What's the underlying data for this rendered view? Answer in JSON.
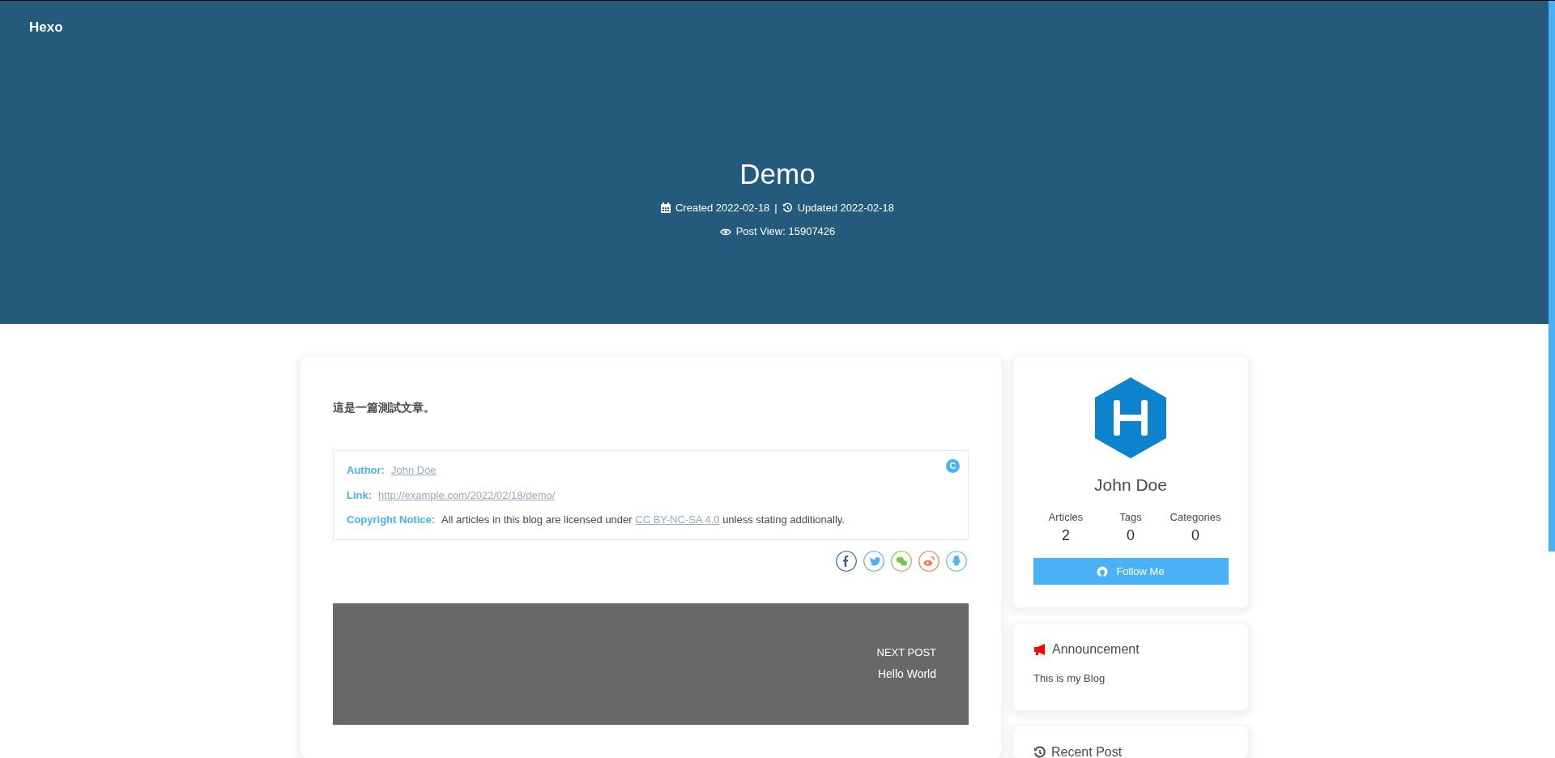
{
  "site": {
    "title": "Hexo"
  },
  "post": {
    "title": "Demo",
    "meta": [
      {
        "kind": "created",
        "text": "Created 2022-02-18"
      },
      {
        "kind": "separator",
        "text": "|"
      },
      {
        "kind": "updated",
        "text": "Updated 2022-02-18"
      }
    ],
    "views": "Post View: 15907426",
    "body": "這是一篇測試文章。"
  },
  "copyright": {
    "badge": "C",
    "rows": [
      {
        "kind": "link",
        "label": "Author:",
        "value": "John Doe"
      },
      {
        "kind": "link",
        "label": "Link:",
        "value": "http://example.com/2022/02/18/demo/"
      },
      {
        "kind": "notice",
        "label": "Copyright Notice:",
        "before": "All articles in this blog are licensed under ",
        "link": "CC BY-NC-SA 4.0",
        "after": " unless stating additionally."
      }
    ]
  },
  "share": [
    {
      "kind": "facebook",
      "color": "#3b5998"
    },
    {
      "kind": "twitter",
      "color": "#55acee"
    },
    {
      "kind": "wechat",
      "color": "#7bc549"
    },
    {
      "kind": "weibo",
      "color": "#ff763b"
    },
    {
      "kind": "qq",
      "color": "#56b6e7"
    }
  ],
  "next_post": {
    "label": "NEXT POST",
    "title": "Hello World"
  },
  "author_card": {
    "name": "John Doe",
    "stats": [
      {
        "label": "Articles",
        "value": "2"
      },
      {
        "label": "Tags",
        "value": "0"
      },
      {
        "label": "Categories",
        "value": "0"
      }
    ],
    "button": "Follow Me"
  },
  "announcement": {
    "title": "Announcement",
    "text": "This is my Blog"
  },
  "recent": {
    "title": "Recent Post"
  }
}
